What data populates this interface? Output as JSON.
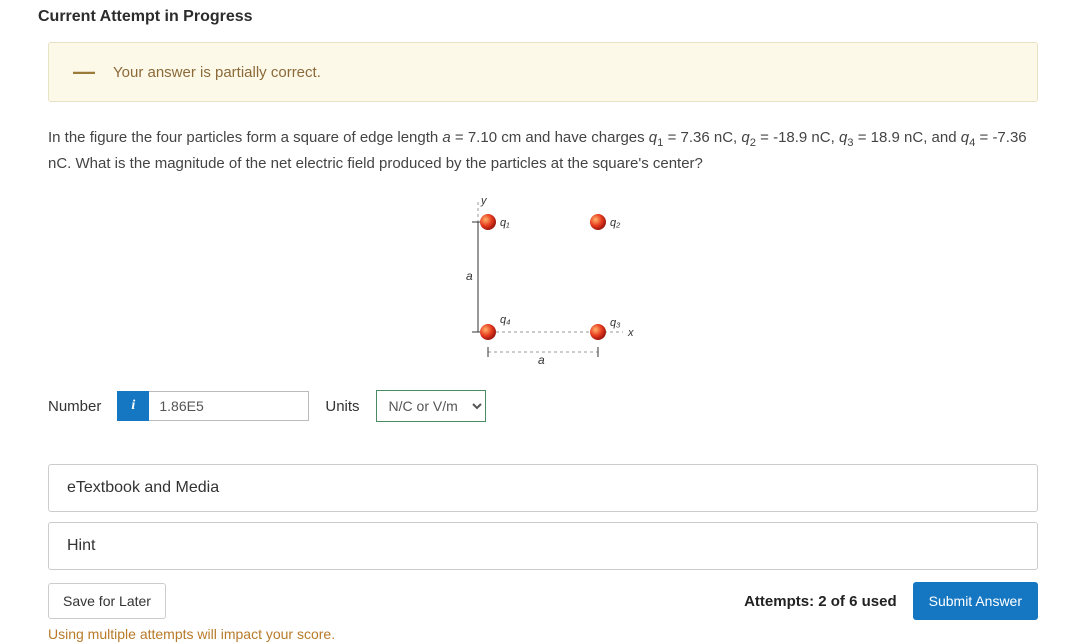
{
  "heading": "Current Attempt in Progress",
  "feedback": "Your answer is partially correct.",
  "question": {
    "p1a": "In the figure the four particles form a square of edge length ",
    "aeq": "a",
    "avalue": " = 7.10 cm and have charges ",
    "q1": "q",
    "q1sub": "1",
    "q1val": " = 7.36 nC, ",
    "q2": "q",
    "q2sub": "2",
    "q2val": " = -18.9 nC, ",
    "q3": "q",
    "q3sub": "3",
    "q3val": " = 18.9 nC, and ",
    "q4": "q",
    "q4sub": "4",
    "q4val": " = -7.36 nC. What is the magnitude of the net electric field produced by the particles at the square's center?"
  },
  "figure": {
    "y": "y",
    "x": "x",
    "a": "a",
    "q1": "q₁",
    "q2": "q₂",
    "q3": "q₃",
    "q4": "q₄"
  },
  "answer": {
    "number_label": "Number",
    "info": "i",
    "number_value": "1.86E5",
    "units_label": "Units",
    "unit_options": [
      "N/C or V/m"
    ],
    "unit_selected": "N/C or V/m"
  },
  "panels": {
    "etextbook": "eTextbook and Media",
    "hint": "Hint"
  },
  "bottom": {
    "save": "Save for Later",
    "attempts": "Attempts: 2 of 6 used",
    "submit": "Submit Answer",
    "warning": "Using multiple attempts will impact your score."
  }
}
